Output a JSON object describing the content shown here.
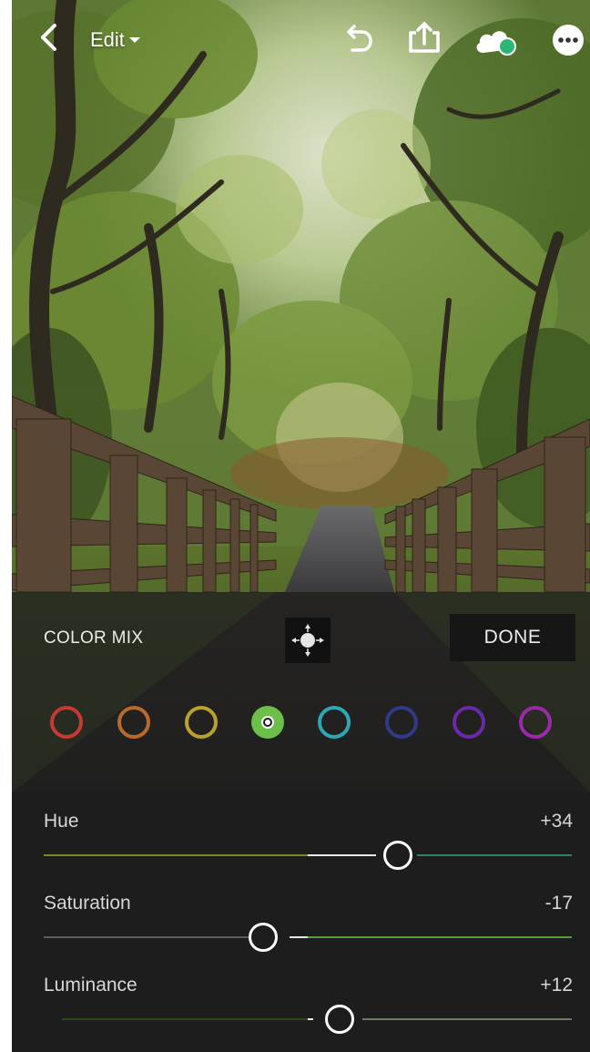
{
  "topbar": {
    "edit_label": "Edit",
    "back_icon": "chevron-left-icon",
    "undo_icon": "undo-icon",
    "share_icon": "share-icon",
    "cloud_icon": "cloud-sync-icon",
    "more_icon": "more-icon",
    "cloud_status_color": "#2bb673"
  },
  "color_mix": {
    "title": "COLOR MIX",
    "target_icon": "targeted-adjustment-icon",
    "done_label": "DONE",
    "swatches": [
      {
        "name": "red",
        "color": "#c53a35",
        "active": false
      },
      {
        "name": "orange",
        "color": "#b86a2a",
        "active": false
      },
      {
        "name": "yellow",
        "color": "#b8a22c",
        "active": false
      },
      {
        "name": "green",
        "color": "#6cc04a",
        "active": true
      },
      {
        "name": "aqua",
        "color": "#2da7b3",
        "active": false
      },
      {
        "name": "blue",
        "color": "#2f3a8a",
        "active": false
      },
      {
        "name": "purple",
        "color": "#6a2aa8",
        "active": false
      },
      {
        "name": "magenta",
        "color": "#9a2aa8",
        "active": false
      }
    ]
  },
  "sliders": {
    "hue": {
      "label": "Hue",
      "value": "+34",
      "amount": 34
    },
    "saturation": {
      "label": "Saturation",
      "value": "-17",
      "amount": -17
    },
    "luminance": {
      "label": "Luminance",
      "value": "+12",
      "amount": 12
    }
  }
}
